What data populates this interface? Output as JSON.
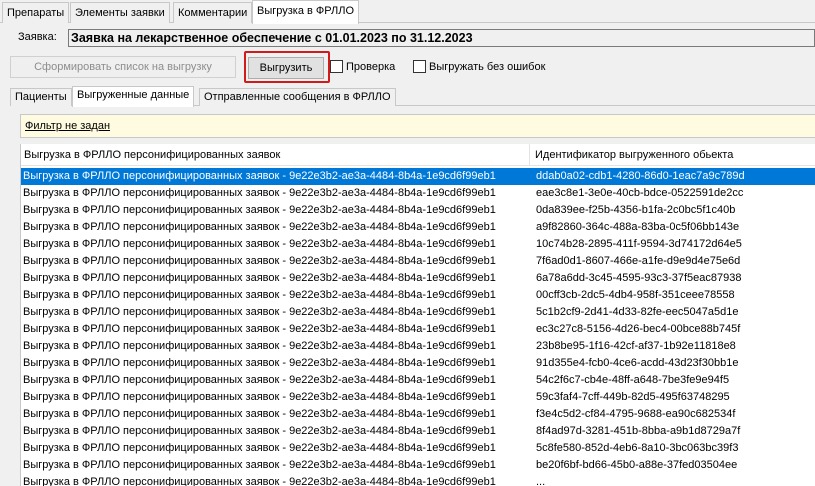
{
  "tabs": [
    "Препараты",
    "Элементы заявки",
    "Комментарии",
    "Выгрузка в ФРЛЛО"
  ],
  "zayavka": {
    "label": "Заявка:",
    "value": "Заявка на лекарственное обеспечение с 01.01.2023 по 31.12.2023"
  },
  "toolbar": {
    "form_list_label": "Сформировать список на выгрузку",
    "upload_label": "Выгрузить",
    "check_label": "Проверка",
    "no_errors_label": "Выгружать без ошибок"
  },
  "subtabs": [
    "Пациенты",
    "Выгруженные данные",
    "Отправленные сообщения в ФРЛЛО"
  ],
  "filter": {
    "label": "Фильтр не задан"
  },
  "grid": {
    "columns": [
      "Выгрузка в ФРЛЛО персонифицированных заявок",
      "Идентификатор выгруженного обьекта"
    ],
    "selected_index": 0,
    "rows": [
      {
        "c1": "Выгрузка в ФРЛЛО персонифицированных заявок - 9e22e3b2-ae3a-4484-8b4a-1e9cd6f99eb1",
        "c2": "ddab0a02-cdb1-4280-86d0-1eac7a9c789d"
      },
      {
        "c1": "Выгрузка в ФРЛЛО персонифицированных заявок - 9e22e3b2-ae3a-4484-8b4a-1e9cd6f99eb1",
        "c2": "eae3c8e1-3e0e-40cb-bdce-0522591de2cc"
      },
      {
        "c1": "Выгрузка в ФРЛЛО персонифицированных заявок - 9e22e3b2-ae3a-4484-8b4a-1e9cd6f99eb1",
        "c2": "0da839ee-f25b-4356-b1fa-2c0bc5f1c40b"
      },
      {
        "c1": "Выгрузка в ФРЛЛО персонифицированных заявок - 9e22e3b2-ae3a-4484-8b4a-1e9cd6f99eb1",
        "c2": "a9f82860-364c-488a-83ba-0c5f06bb143e"
      },
      {
        "c1": "Выгрузка в ФРЛЛО персонифицированных заявок - 9e22e3b2-ae3a-4484-8b4a-1e9cd6f99eb1",
        "c2": "10c74b28-2895-411f-9594-3d74172d64e5"
      },
      {
        "c1": "Выгрузка в ФРЛЛО персонифицированных заявок - 9e22e3b2-ae3a-4484-8b4a-1e9cd6f99eb1",
        "c2": "7f6ad0d1-8607-466e-a1fe-d9e9d4e75e6d"
      },
      {
        "c1": "Выгрузка в ФРЛЛО персонифицированных заявок - 9e22e3b2-ae3a-4484-8b4a-1e9cd6f99eb1",
        "c2": "6a78a6dd-3c45-4595-93c3-37f5eac87938"
      },
      {
        "c1": "Выгрузка в ФРЛЛО персонифицированных заявок - 9e22e3b2-ae3a-4484-8b4a-1e9cd6f99eb1",
        "c2": "00cff3cb-2dc5-4db4-958f-351ceee78558"
      },
      {
        "c1": "Выгрузка в ФРЛЛО персонифицированных заявок - 9e22e3b2-ae3a-4484-8b4a-1e9cd6f99eb1",
        "c2": "5c1b2cf9-2d41-4d33-82fe-eec5047a5d1e"
      },
      {
        "c1": "Выгрузка в ФРЛЛО персонифицированных заявок - 9e22e3b2-ae3a-4484-8b4a-1e9cd6f99eb1",
        "c2": "ec3c27c8-5156-4d26-bec4-00bce88b745f"
      },
      {
        "c1": "Выгрузка в ФРЛЛО персонифицированных заявок - 9e22e3b2-ae3a-4484-8b4a-1e9cd6f99eb1",
        "c2": "23b8be95-1f16-42cf-af37-1b92e11818e8"
      },
      {
        "c1": "Выгрузка в ФРЛЛО персонифицированных заявок - 9e22e3b2-ae3a-4484-8b4a-1e9cd6f99eb1",
        "c2": "91d355e4-fcb0-4ce6-acdd-43d23f30bb1e"
      },
      {
        "c1": "Выгрузка в ФРЛЛО персонифицированных заявок - 9e22e3b2-ae3a-4484-8b4a-1e9cd6f99eb1",
        "c2": "54c2f6c7-cb4e-48ff-a648-7be3fe9e94f5"
      },
      {
        "c1": "Выгрузка в ФРЛЛО персонифицированных заявок - 9e22e3b2-ae3a-4484-8b4a-1e9cd6f99eb1",
        "c2": "59c3faf4-7cff-449b-82d5-495f63748295"
      },
      {
        "c1": "Выгрузка в ФРЛЛО персонифицированных заявок - 9e22e3b2-ae3a-4484-8b4a-1e9cd6f99eb1",
        "c2": "f3e4c5d2-cf84-4795-9688-ea90c682534f"
      },
      {
        "c1": "Выгрузка в ФРЛЛО персонифицированных заявок - 9e22e3b2-ae3a-4484-8b4a-1e9cd6f99eb1",
        "c2": "8f4ad97d-3281-451b-8bba-a9b1d8729a7f"
      },
      {
        "c1": "Выгрузка в ФРЛЛО персонифицированных заявок - 9e22e3b2-ae3a-4484-8b4a-1e9cd6f99eb1",
        "c2": "5c8fe580-852d-4eb6-8a10-3bc063bc39f3"
      },
      {
        "c1": "Выгрузка в ФРЛЛО персонифицированных заявок - 9e22e3b2-ae3a-4484-8b4a-1e9cd6f99eb1",
        "c2": "be20f6bf-bd66-45b0-a88e-37fed03504ee"
      },
      {
        "c1": "Выгрузка в ФРЛЛО персонифицированных заявок - 9e22e3b2-ae3a-4484-8b4a-1e9cd6f99eb1",
        "c2": "..."
      }
    ]
  },
  "colors": {
    "selection": "#0078d7",
    "filter_bg": "#fffbe0",
    "highlight_border": "#d11a1a"
  }
}
